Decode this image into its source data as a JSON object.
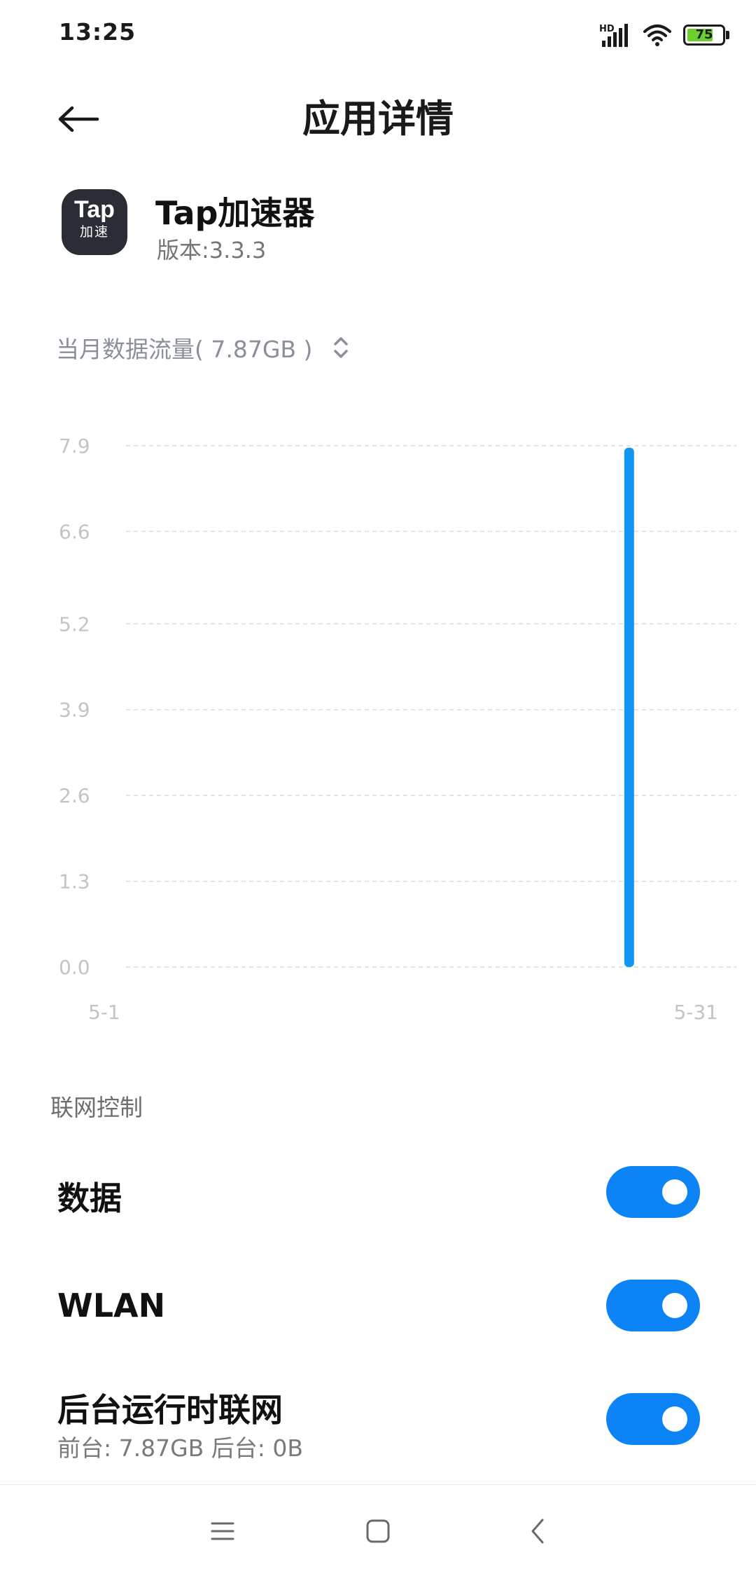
{
  "status_bar": {
    "time": "13:25",
    "network_type": "HD",
    "battery_level": "75",
    "battery_fraction": 0.75,
    "icons": [
      "hd-signal-icon",
      "wifi-icon",
      "battery-icon"
    ]
  },
  "header": {
    "back_icon": "back-arrow-icon",
    "title": "应用详情"
  },
  "app": {
    "icon_main_text": "Tap",
    "icon_sub_text": "加速",
    "name": "Tap加速器",
    "version": "版本:3.3.3"
  },
  "usage": {
    "label": "当月数据流量( 7.87GB )",
    "selector_icon": "up-down-chevron-icon"
  },
  "chart_data": {
    "type": "bar",
    "x_labels": [
      "5-1",
      "5-31"
    ],
    "x_range": [
      1,
      31
    ],
    "y_ticks": [
      "7.9",
      "6.6",
      "5.2",
      "3.9",
      "2.6",
      "1.3",
      "0.0"
    ],
    "y_tick_values": [
      7.9,
      6.6,
      5.2,
      3.9,
      2.6,
      1.3,
      0.0
    ],
    "ylim": [
      0,
      7.9
    ],
    "grid": true,
    "bars": [
      {
        "day": 28,
        "value": 7.87
      }
    ],
    "colors": {
      "bar": "#1296f2",
      "grid": "#dcdcdc",
      "tick_label": "#c2c4c8"
    }
  },
  "network_control": {
    "section_title": "联网控制",
    "rows": [
      {
        "label": "数据",
        "enabled": true
      },
      {
        "label": "WLAN",
        "enabled": true
      },
      {
        "label": "后台运行时联网",
        "sub": "前台: 7.87GB  后台: 0B",
        "enabled": true
      }
    ]
  },
  "nav_bar": {
    "icons": [
      "menu-icon",
      "home-icon",
      "back-icon"
    ]
  },
  "colors": {
    "accent": "#0d84f5",
    "muted_text": "#8a8f9a"
  }
}
